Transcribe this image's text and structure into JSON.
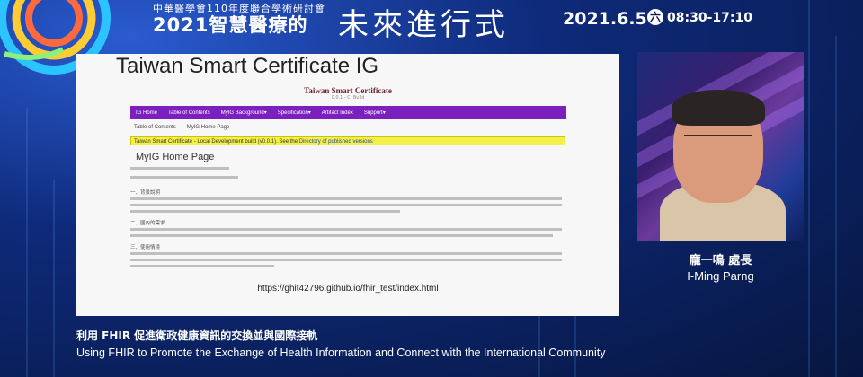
{
  "header": {
    "conference": "中華醫學會110年度聯合學術研討會",
    "title_main": "2021智慧醫療的",
    "title_future": "未來進行式",
    "date": "2021.6.5",
    "weekday": "六",
    "time": "08:30-17:10"
  },
  "slide": {
    "title": "Taiwan Smart Certificate IG",
    "site_title": "Taiwan Smart Certificate",
    "site_version": "0.0.1 - CI Build",
    "nav": [
      "IG Home",
      "Table of Contents",
      "MyIG Background▾",
      "Specification▾",
      "Artifact Index",
      "Support▾"
    ],
    "breadcrumbs": [
      "Table of Contents",
      "MyIG Home Page"
    ],
    "banner_text": "Taiwan Smart Certificate - Local Development build (v0.0.1). See the ",
    "banner_link": "Directory of published versions",
    "page_heading": "MyIG Home Page",
    "sections": [
      "一、背景說明",
      "二、國內的需求",
      "三、使用情境"
    ],
    "url": "https://ghit42796.github.io/fhir_test/index.html"
  },
  "speaker": {
    "name_zh": "龐一鳴 處長",
    "name_en": "I-Ming Parng"
  },
  "talk": {
    "title_zh": "利用 FHIR 促進衛政健康資訊的交換並與國際接軌",
    "title_en": "Using FHIR to Promote the Exchange of Health Information and Connect with the International Community"
  },
  "colors": {
    "background": "#0b1d5a",
    "nav_purple": "#7b1fbf",
    "banner_yellow": "#f4f04a"
  }
}
